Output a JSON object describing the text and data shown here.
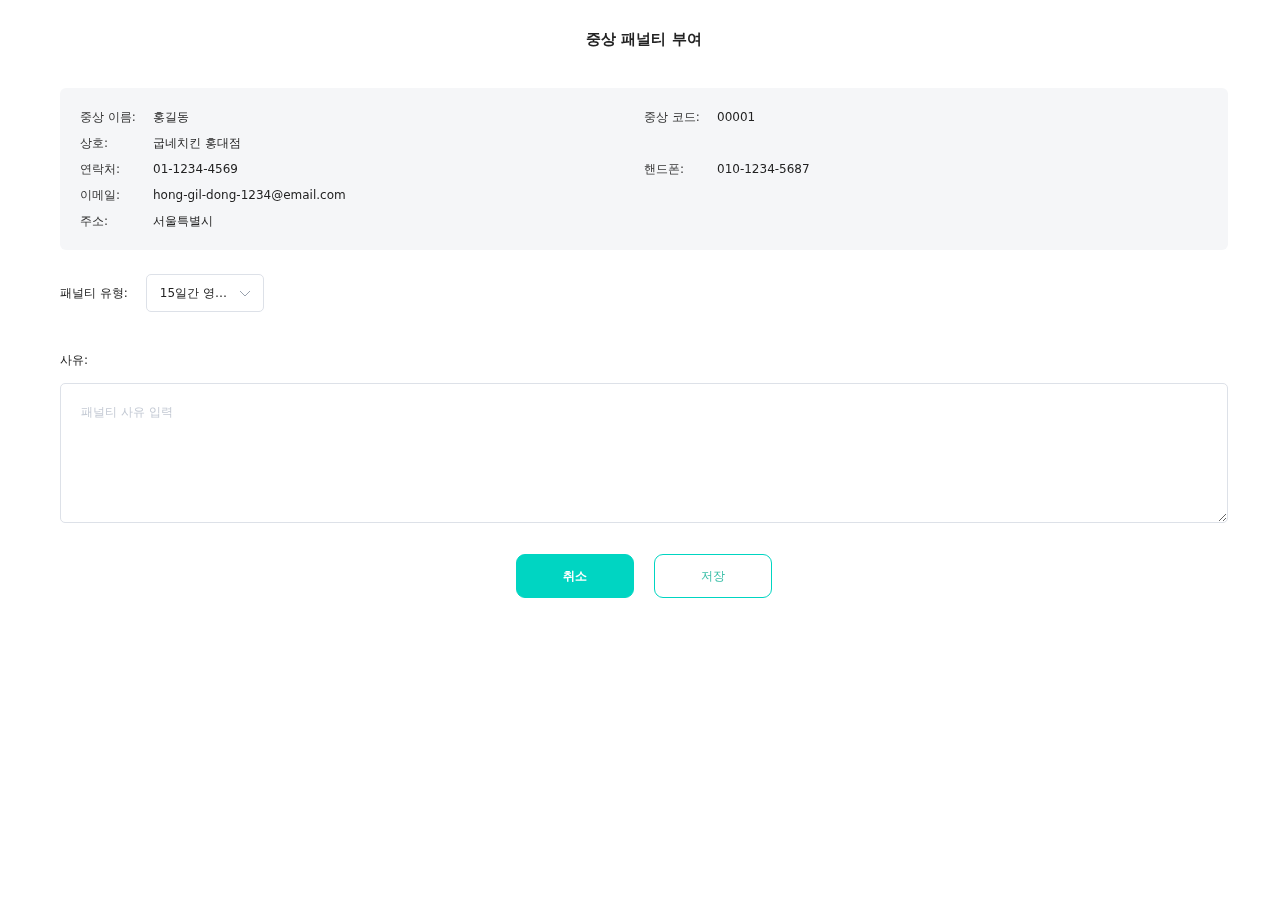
{
  "title": "중상 패널티 부여",
  "info_rows": [
    {
      "cells": [
        {
          "label": "중상 이름:",
          "value": "홍길동"
        },
        {
          "label": "중상 코드:",
          "value": "00001"
        }
      ]
    },
    {
      "cells": [
        {
          "label": "상호:",
          "value": "굽네치킨 홍대점"
        }
      ]
    },
    {
      "cells": [
        {
          "label": "연락처:",
          "value": "01-1234-4569"
        },
        {
          "label": "핸드폰:",
          "value": "010-1234-5687"
        }
      ]
    },
    {
      "cells": [
        {
          "label": "이메일:",
          "value": "hong-gil-dong-1234@email.com"
        }
      ]
    },
    {
      "cells": [
        {
          "label": "주소:",
          "value": "서울특별시"
        }
      ]
    }
  ],
  "penalty_type": {
    "label": "패널티 유형:",
    "value": "15일간 영…"
  },
  "reason": {
    "label": "사유:",
    "placeholder": "패널티 사유 입력"
  },
  "buttons": [
    {
      "label": "취소",
      "kind": "primary"
    },
    {
      "label": "저장",
      "kind": "secondary"
    }
  ]
}
